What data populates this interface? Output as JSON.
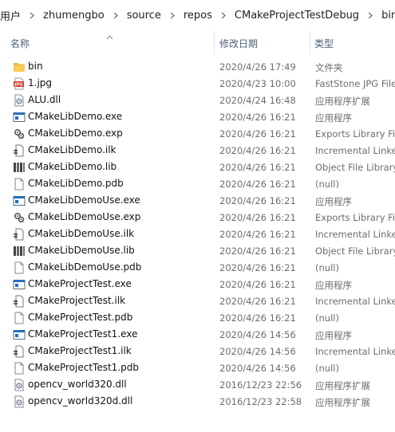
{
  "breadcrumb": [
    "用户",
    "zhumengbo",
    "source",
    "repos",
    "CMakeProjectTestDebug",
    "bin"
  ],
  "columns": {
    "name": "名称",
    "date": "修改日期",
    "type": "类型"
  },
  "files": [
    {
      "name": "bin",
      "date": "2020/4/26 17:49",
      "type": "文件夹",
      "icon": "folder-icon"
    },
    {
      "name": "1.jpg",
      "date": "2020/4/23 10:00",
      "type": "FastStone JPG File",
      "icon": "jpg-file-icon"
    },
    {
      "name": "ALU.dll",
      "date": "2020/4/24 16:48",
      "type": "应用程序扩展",
      "icon": "dll-file-icon"
    },
    {
      "name": "CMakeLibDemo.exe",
      "date": "2020/4/26 16:21",
      "type": "应用程序",
      "icon": "exe-file-icon"
    },
    {
      "name": "CMakeLibDemo.exp",
      "date": "2020/4/26 16:21",
      "type": "Exports Library File",
      "icon": "exp-file-icon"
    },
    {
      "name": "CMakeLibDemo.ilk",
      "date": "2020/4/26 16:21",
      "type": "Incremental Linker File",
      "icon": "ilk-file-icon"
    },
    {
      "name": "CMakeLibDemo.lib",
      "date": "2020/4/26 16:21",
      "type": "Object File Library",
      "icon": "lib-file-icon"
    },
    {
      "name": "CMakeLibDemo.pdb",
      "date": "2020/4/26 16:21",
      "type": "(null)",
      "icon": "blank-file-icon"
    },
    {
      "name": "CMakeLibDemoUse.exe",
      "date": "2020/4/26 16:21",
      "type": "应用程序",
      "icon": "exe-file-icon"
    },
    {
      "name": "CMakeLibDemoUse.exp",
      "date": "2020/4/26 16:21",
      "type": "Exports Library File",
      "icon": "exp-file-icon"
    },
    {
      "name": "CMakeLibDemoUse.ilk",
      "date": "2020/4/26 16:21",
      "type": "Incremental Linker File",
      "icon": "ilk-file-icon"
    },
    {
      "name": "CMakeLibDemoUse.lib",
      "date": "2020/4/26 16:21",
      "type": "Object File Library",
      "icon": "lib-file-icon"
    },
    {
      "name": "CMakeLibDemoUse.pdb",
      "date": "2020/4/26 16:21",
      "type": "(null)",
      "icon": "blank-file-icon"
    },
    {
      "name": "CMakeProjectTest.exe",
      "date": "2020/4/26 16:21",
      "type": "应用程序",
      "icon": "exe-file-icon"
    },
    {
      "name": "CMakeProjectTest.ilk",
      "date": "2020/4/26 16:21",
      "type": "Incremental Linker File",
      "icon": "ilk-file-icon"
    },
    {
      "name": "CMakeProjectTest.pdb",
      "date": "2020/4/26 16:21",
      "type": "(null)",
      "icon": "blank-file-icon"
    },
    {
      "name": "CMakeProjectTest1.exe",
      "date": "2020/4/26 14:56",
      "type": "应用程序",
      "icon": "exe-file-icon"
    },
    {
      "name": "CMakeProjectTest1.ilk",
      "date": "2020/4/26 14:56",
      "type": "Incremental Linker File",
      "icon": "ilk-file-icon"
    },
    {
      "name": "CMakeProjectTest1.pdb",
      "date": "2020/4/26 14:56",
      "type": "(null)",
      "icon": "blank-file-icon"
    },
    {
      "name": "opencv_world320.dll",
      "date": "2016/12/23 22:56",
      "type": "应用程序扩展",
      "icon": "dll-file-icon"
    },
    {
      "name": "opencv_world320d.dll",
      "date": "2016/12/23 22:58",
      "type": "应用程序扩展",
      "icon": "dll-file-icon"
    }
  ],
  "colors": {
    "header_text": "#4c607a",
    "folder": "#f3c04a",
    "exe_blue": "#1f6fc5",
    "jpg_red": "#d23b2f"
  }
}
